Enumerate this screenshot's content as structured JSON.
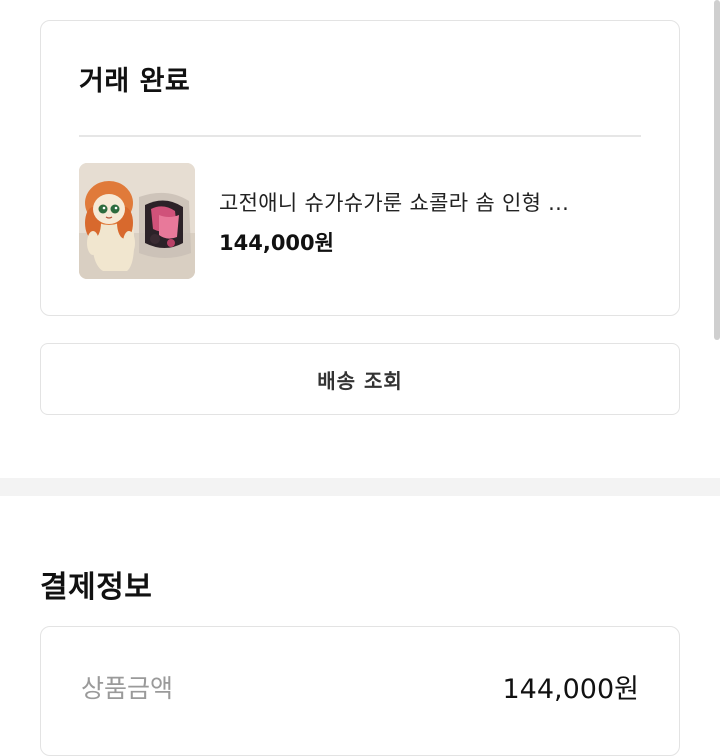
{
  "order": {
    "status_title": "거래 완료",
    "product": {
      "name": "고전애니 슈가슈가룬 쇼콜라 솜 인형 ...",
      "price": "144,000원",
      "thumbnail_icon": "plush-doll-photo"
    },
    "shipping_button_label": "배송 조회"
  },
  "payment": {
    "section_title": "결제정보",
    "rows": [
      {
        "label": "상품금액",
        "value": "144,000원"
      }
    ]
  },
  "colors": {
    "border": "#e3e3e3",
    "section_gap": "#f3f3f3",
    "muted_text": "#9a9a9a"
  }
}
